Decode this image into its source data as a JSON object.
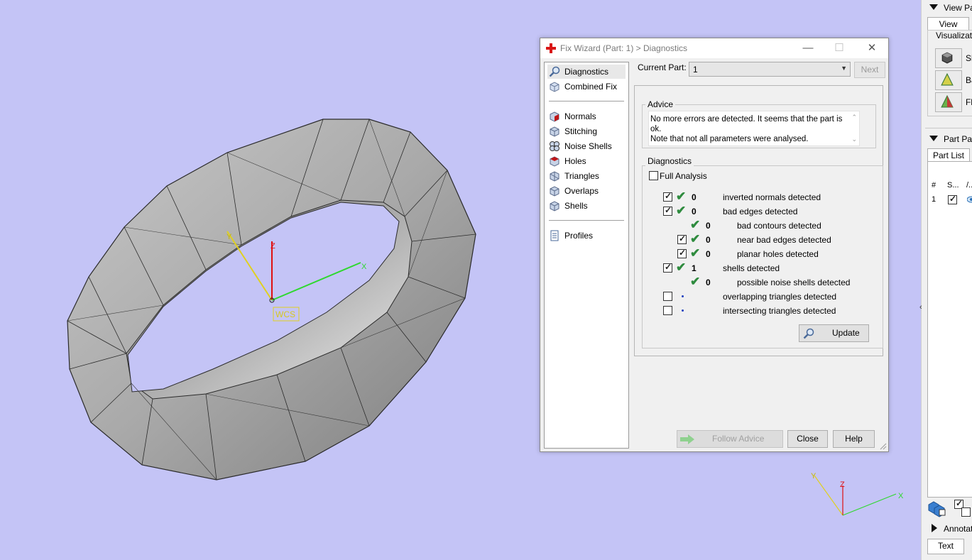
{
  "viewport": {
    "wcs_label": "WCS",
    "axes": {
      "x": "X",
      "y": "Y",
      "z": "Z"
    },
    "colors": {
      "background": "#c4c4f6",
      "x_axis": "#2ed82e",
      "y_axis": "#e0d020",
      "z_axis": "#e01010",
      "mesh": "#a8a8a8"
    }
  },
  "dialog": {
    "title": "Fix Wizard (Part: 1) > Diagnostics",
    "title_icon": "red-cross-icon",
    "nav": {
      "top_items": [
        {
          "label": "Diagnostics",
          "icon": "magnifier-icon",
          "selected": true
        },
        {
          "label": "Combined Fix",
          "icon": "cube-icon"
        }
      ],
      "fix_items": [
        {
          "label": "Normals",
          "icon": "normals-cube-icon"
        },
        {
          "label": "Stitching",
          "icon": "stitching-cube-icon"
        },
        {
          "label": "Noise Shells",
          "icon": "noise-shells-icon"
        },
        {
          "label": "Holes",
          "icon": "holes-cube-icon"
        },
        {
          "label": "Triangles",
          "icon": "triangles-icon"
        },
        {
          "label": "Overlaps",
          "icon": "overlaps-cube-icon"
        },
        {
          "label": "Shells",
          "icon": "shells-cube-icon"
        }
      ],
      "profiles": {
        "label": "Profiles",
        "icon": "document-icon"
      }
    },
    "current_part_label": "Current Part:",
    "current_part_value": "1",
    "next_label": "Next",
    "advice": {
      "title": "Advice",
      "line1": "No more errors are detected. It seems that the part is ok.",
      "line2": "Note that not all parameters were analysed."
    },
    "diagnostics": {
      "title": "Diagnostics",
      "full_analysis_label": "Full Analysis",
      "rows": [
        {
          "checkbox": true,
          "checked": true,
          "status": "ok",
          "count": "0",
          "label": "inverted normals detected",
          "indent": 0
        },
        {
          "checkbox": true,
          "checked": true,
          "status": "ok",
          "count": "0",
          "label": "bad edges detected",
          "indent": 0
        },
        {
          "checkbox": false,
          "status": "ok",
          "count": "0",
          "label": "bad contours detected",
          "indent": 1
        },
        {
          "checkbox": true,
          "checked": true,
          "status": "ok",
          "count": "0",
          "label": "near bad edges detected",
          "indent": 1
        },
        {
          "checkbox": true,
          "checked": true,
          "status": "ok",
          "count": "0",
          "label": "planar holes detected",
          "indent": 1
        },
        {
          "checkbox": true,
          "checked": true,
          "status": "ok",
          "count": "1",
          "label": "shells detected",
          "indent": 0
        },
        {
          "checkbox": false,
          "status": "ok",
          "count": "0",
          "label": "possible noise shells detected",
          "indent": 1
        },
        {
          "checkbox": true,
          "checked": false,
          "status": "pending",
          "count": "",
          "label": "overlapping triangles detected",
          "indent": 0
        },
        {
          "checkbox": true,
          "checked": false,
          "status": "pending",
          "count": "",
          "label": "intersecting triangles detected",
          "indent": 0
        }
      ],
      "update_label": "Update"
    },
    "buttons": {
      "follow_advice": "Follow Advice",
      "close": "Close",
      "help": "Help"
    }
  },
  "right_panel": {
    "view_pages_title": "View Pag",
    "view_tab": "View",
    "visualization_label": "Visualizatio",
    "vis_items": [
      "Sh",
      "Ba",
      "Fl"
    ],
    "part_pages_title": "Part Pag",
    "part_list_tab": "Part List",
    "columns": [
      "#",
      "S...",
      "/..."
    ],
    "row": {
      "number": "1"
    },
    "annotations_title": "Annotat",
    "text_tab": "Text"
  }
}
